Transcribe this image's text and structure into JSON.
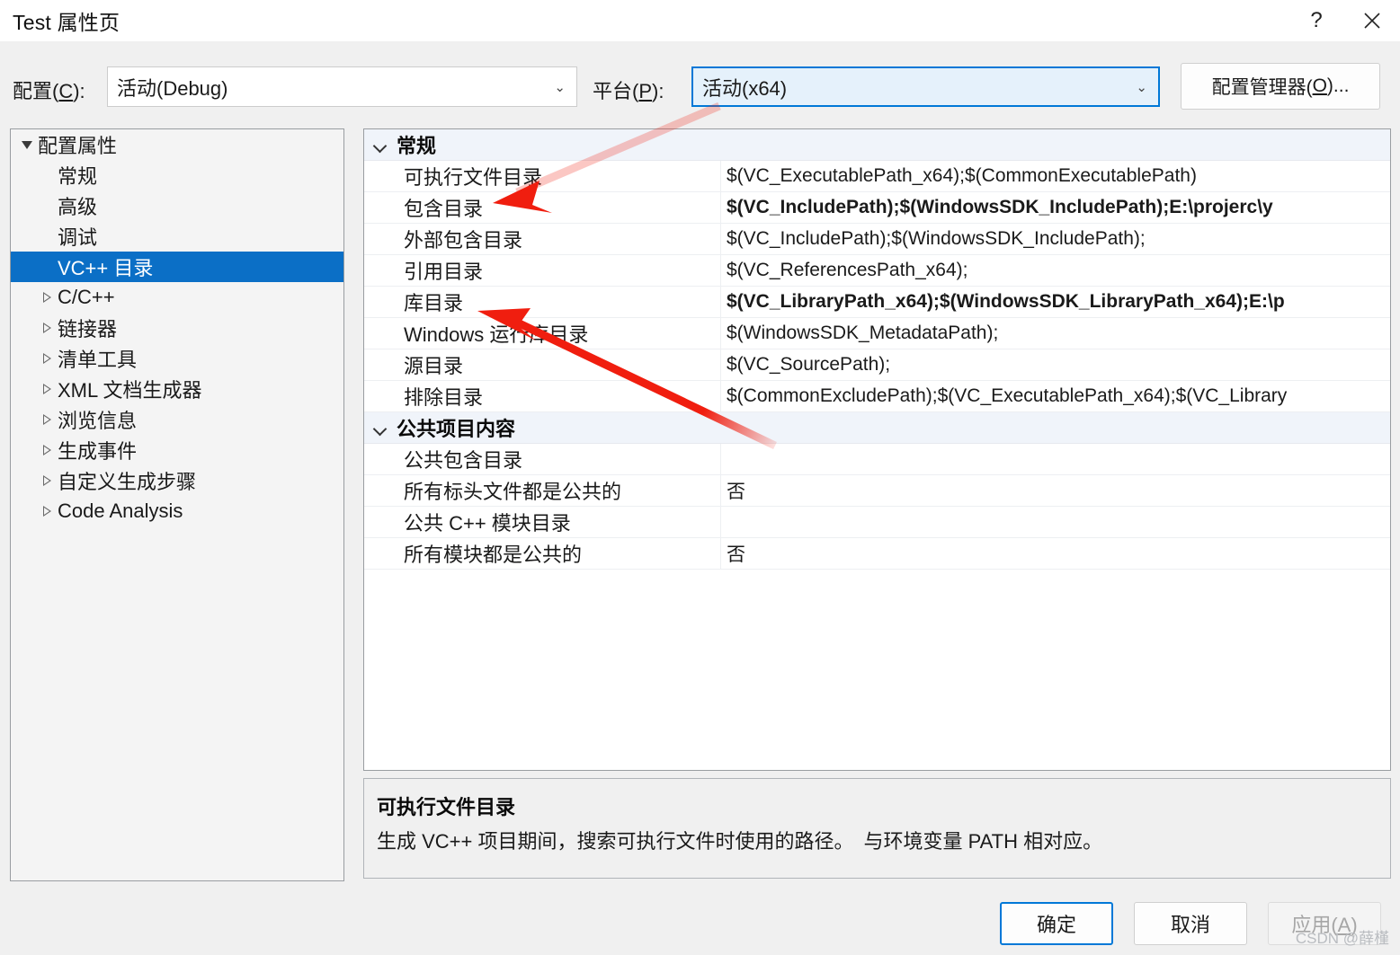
{
  "window": {
    "title": "Test 属性页",
    "help_button": "?",
    "close_button": "✕"
  },
  "toolbar": {
    "configuration_label": "配置(C):",
    "configuration_label_prefix": "配置(",
    "configuration_accel": "C",
    "configuration_label_suffix": "):",
    "configuration_value": "活动(Debug)",
    "platform_label_prefix": "平台(",
    "platform_accel": "P",
    "platform_label_suffix": "):",
    "platform_value": "活动(x64)",
    "config_manager_prefix": "配置管理器(",
    "config_manager_accel": "O",
    "config_manager_suffix": ")...",
    "caret_glyph": "⌄"
  },
  "tree": {
    "items": [
      {
        "label": "配置属性",
        "level": 0,
        "twisty": "expanded",
        "selected": false
      },
      {
        "label": "常规",
        "level": 1,
        "twisty": "none",
        "selected": false
      },
      {
        "label": "高级",
        "level": 1,
        "twisty": "none",
        "selected": false
      },
      {
        "label": "调试",
        "level": 1,
        "twisty": "none",
        "selected": false
      },
      {
        "label": "VC++ 目录",
        "level": 1,
        "twisty": "none",
        "selected": true
      },
      {
        "label": "C/C++",
        "level": 1,
        "twisty": "collapsed",
        "selected": false
      },
      {
        "label": "链接器",
        "level": 1,
        "twisty": "collapsed",
        "selected": false
      },
      {
        "label": "清单工具",
        "level": 1,
        "twisty": "collapsed",
        "selected": false
      },
      {
        "label": "XML 文档生成器",
        "level": 1,
        "twisty": "collapsed",
        "selected": false
      },
      {
        "label": "浏览信息",
        "level": 1,
        "twisty": "collapsed",
        "selected": false
      },
      {
        "label": "生成事件",
        "level": 1,
        "twisty": "collapsed",
        "selected": false
      },
      {
        "label": "自定义生成步骤",
        "level": 1,
        "twisty": "collapsed",
        "selected": false
      },
      {
        "label": "Code Analysis",
        "level": 1,
        "twisty": "collapsed",
        "selected": false
      }
    ]
  },
  "grid": {
    "sections": [
      {
        "title": "常规",
        "expanded": true,
        "rows": [
          {
            "name": "可执行文件目录",
            "value": "$(VC_ExecutablePath_x64);$(CommonExecutablePath)",
            "modified": false
          },
          {
            "name": "包含目录",
            "value": "$(VC_IncludePath);$(WindowsSDK_IncludePath);E:\\projerc\\y",
            "modified": true
          },
          {
            "name": "外部包含目录",
            "value": "$(VC_IncludePath);$(WindowsSDK_IncludePath);",
            "modified": false
          },
          {
            "name": "引用目录",
            "value": "$(VC_ReferencesPath_x64);",
            "modified": false
          },
          {
            "name": "库目录",
            "value": "$(VC_LibraryPath_x64);$(WindowsSDK_LibraryPath_x64);E:\\p",
            "modified": true
          },
          {
            "name": "Windows 运行库目录",
            "value": "$(WindowsSDK_MetadataPath);",
            "modified": false
          },
          {
            "name": "源目录",
            "value": "$(VC_SourcePath);",
            "modified": false
          },
          {
            "name": "排除目录",
            "value": "$(CommonExcludePath);$(VC_ExecutablePath_x64);$(VC_Library",
            "modified": false
          }
        ]
      },
      {
        "title": "公共项目内容",
        "expanded": true,
        "rows": [
          {
            "name": "公共包含目录",
            "value": "",
            "modified": false
          },
          {
            "name": "所有标头文件都是公共的",
            "value": "否",
            "modified": false
          },
          {
            "name": "公共 C++ 模块目录",
            "value": "",
            "modified": false
          },
          {
            "name": "所有模块都是公共的",
            "value": "否",
            "modified": false
          }
        ]
      }
    ]
  },
  "description": {
    "title": "可执行文件目录",
    "body": "生成 VC++ 项目期间，搜索可执行文件时使用的路径。　与环境变量 PATH 相对应。"
  },
  "footer": {
    "ok_label": "确定",
    "cancel_label": "取消",
    "apply_prefix": "应用(",
    "apply_accel": "A",
    "apply_suffix": ")",
    "apply_disabled": true
  },
  "annotations": {
    "color": "#f01e0f",
    "arrow_count": 2
  },
  "watermark": {
    "text": "CSDN @薛槿"
  }
}
